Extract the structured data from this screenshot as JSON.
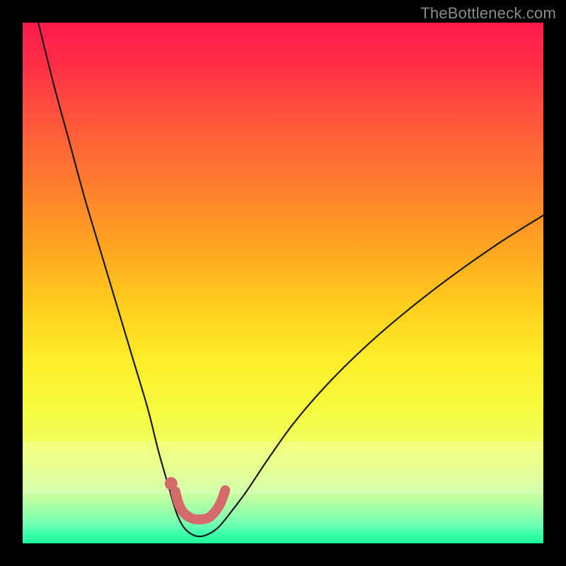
{
  "watermark": {
    "text": "TheBottleneck.com"
  },
  "colors": {
    "curve_stroke": "#1a1a1a",
    "accent_stroke": "#d46a6a",
    "accent_fill": "#d46a6a"
  },
  "chart_data": {
    "type": "line",
    "title": "",
    "xlabel": "",
    "ylabel": "",
    "xlim": [
      0,
      100
    ],
    "ylim": [
      0,
      100
    ],
    "grid": false,
    "legend": false,
    "series": [
      {
        "name": "bottleneck-curve",
        "x": [
          3,
          6,
          9,
          12,
          15,
          18,
          21,
          24,
          26,
          28,
          29.5,
          31,
          33,
          35,
          37.5,
          40,
          43,
          47,
          52,
          58,
          65,
          73,
          82,
          92,
          100
        ],
        "values": [
          100,
          88,
          77,
          66,
          56,
          46,
          36,
          26,
          18,
          11,
          6,
          3,
          1.5,
          1.5,
          3,
          6,
          10,
          16,
          23,
          30,
          37,
          44,
          51,
          58,
          63
        ]
      }
    ],
    "accent": {
      "point": {
        "x": 28.5,
        "y_pct_from_top": 88.5
      },
      "path_pct": [
        [
          29.3,
          90.0
        ],
        [
          30.0,
          92.5
        ],
        [
          31.0,
          94.2
        ],
        [
          32.5,
          95.2
        ],
        [
          34.2,
          95.4
        ],
        [
          35.8,
          95.0
        ],
        [
          37.2,
          93.6
        ],
        [
          38.2,
          91.8
        ],
        [
          38.9,
          89.8
        ]
      ]
    }
  }
}
